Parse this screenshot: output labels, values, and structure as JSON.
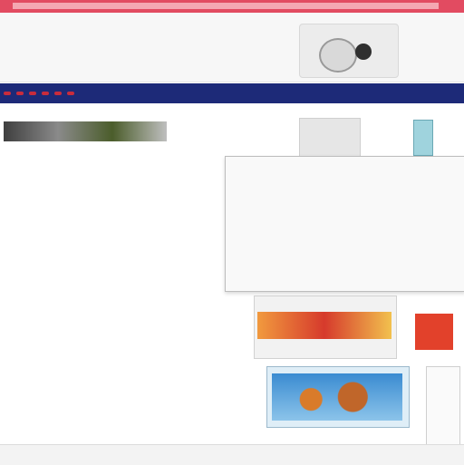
{
  "header": {
    "site_title": "",
    "tagline": "",
    "links": ""
  },
  "nav": {
    "items": [
      "",
      "",
      "",
      "",
      "",
      ""
    ]
  },
  "left": {
    "lines_top": [
      "",
      "",
      "",
      "",
      ""
    ],
    "headline": "",
    "sub": "",
    "lines_mid": [
      "",
      "",
      ""
    ],
    "lines_bottom": [
      "",
      "",
      "",
      "",
      "",
      "",
      "",
      "",
      "",
      "",
      "",
      "",
      "",
      "",
      ""
    ]
  },
  "panel": {
    "title": "",
    "lines": [
      "",
      "",
      "",
      "",
      "",
      "",
      ""
    ]
  },
  "promo": {
    "label": ""
  },
  "footer": {
    "text": ""
  },
  "colors": {
    "top_strip": "#e24b61",
    "nav_bg": "#1d2a78",
    "nav_item": "#c92c3c",
    "headline_green": "#2e6a14"
  }
}
